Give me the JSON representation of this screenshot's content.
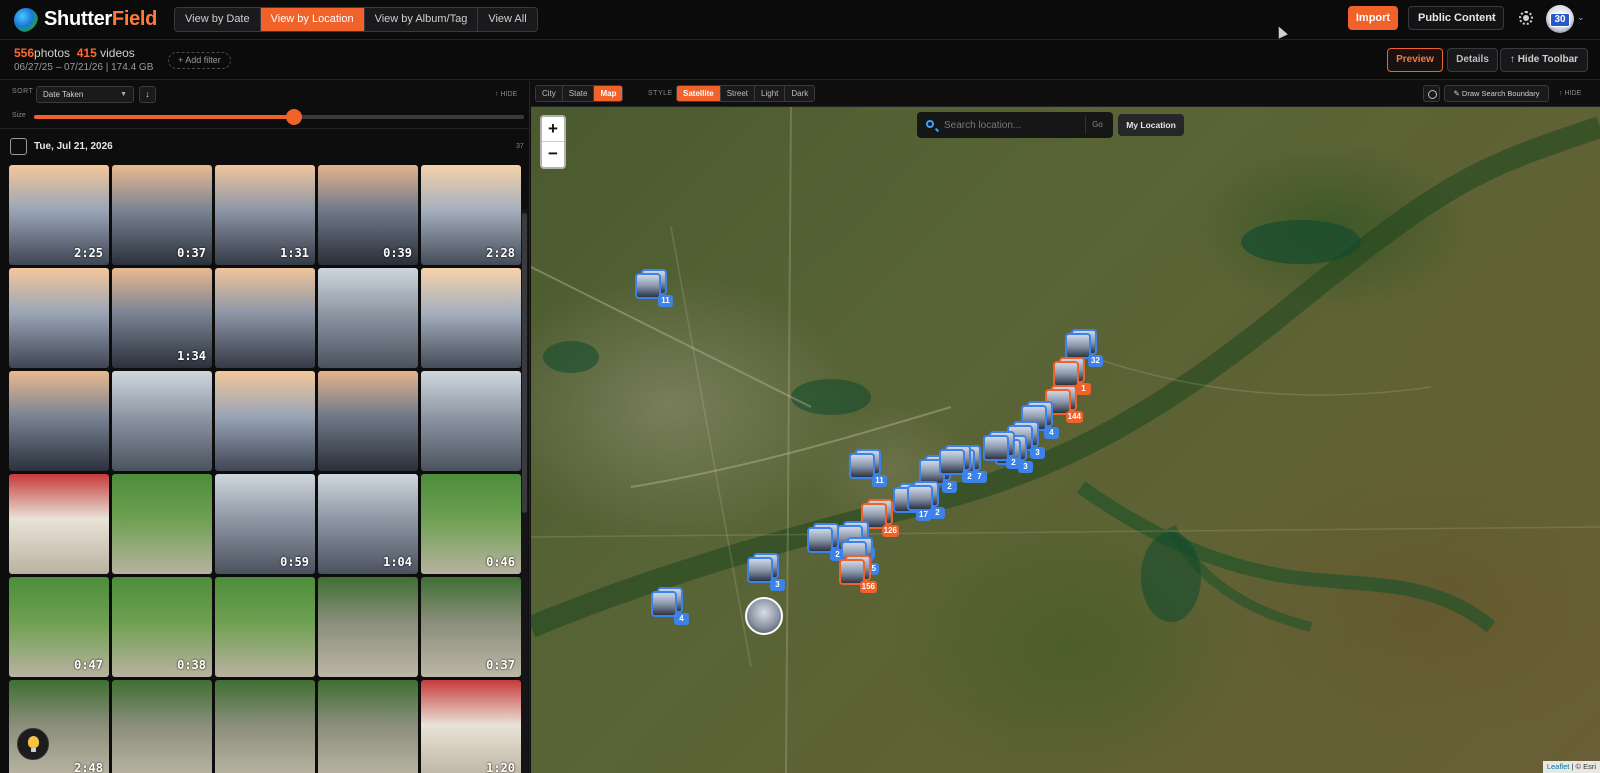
{
  "app": {
    "name_part1": "Shutter",
    "name_part2": "Field"
  },
  "header": {
    "view_tabs": [
      "View by Date",
      "View by Location",
      "View by Album/Tag",
      "View All"
    ],
    "import_label": "Import",
    "content_filter": "Public Content",
    "avatar_badge": "30"
  },
  "stats": {
    "photos_count": "556",
    "photos_label": "photos",
    "videos_count": "415",
    "videos_label": "videos",
    "date_range": "06/27/25 – 07/21/26 | 174.4 GB",
    "add_filter": "+ Add filter"
  },
  "toolbar_right": {
    "preview": "Preview",
    "details": "Details",
    "hide_toolbar": "↑ Hide Toolbar"
  },
  "left": {
    "sort_label": "SORT",
    "sort_value": "Date Taken",
    "sort_dir": "↓",
    "hide_label": "↑ HIDE",
    "size_label": "Size",
    "size_value": 0.53,
    "group_date": "Tue, Jul 21, 2026",
    "group_count": "37",
    "durations": [
      "2:25",
      "0:37",
      "1:31",
      "0:39",
      "2:28",
      "",
      "1:34",
      "",
      "",
      "",
      "",
      "",
      "",
      "",
      "",
      "",
      "",
      "0:59",
      "1:04",
      "0:46",
      "0:47",
      "0:38",
      "",
      "",
      "0:37",
      "2:48",
      "",
      "",
      "",
      "1:20"
    ]
  },
  "map": {
    "scale_tabs": [
      "City",
      "State",
      "Map"
    ],
    "style_label": "STYLE",
    "style_tabs": [
      "Satellite",
      "Street",
      "Light",
      "Dark"
    ],
    "draw_boundary": "✎ Draw Search Boundary",
    "hide_label": "↑ HIDE",
    "search_placeholder": "Search location...",
    "go_label": "Go",
    "my_location": "My Location",
    "zoom_in": "+",
    "zoom_out": "−",
    "attribution_leaflet": "Leaflet",
    "attribution_rest": " | © Esri",
    "clusters": [
      "11",
      "32",
      "1",
      "144",
      "4",
      "3",
      "3",
      "2",
      "7",
      "2",
      "2",
      "11",
      "17",
      "2",
      "126",
      "134",
      "2",
      "15",
      "156",
      "3",
      "4"
    ]
  },
  "colors": {
    "accent": "#f0622a",
    "cluster_blue": "#3d82e8"
  }
}
